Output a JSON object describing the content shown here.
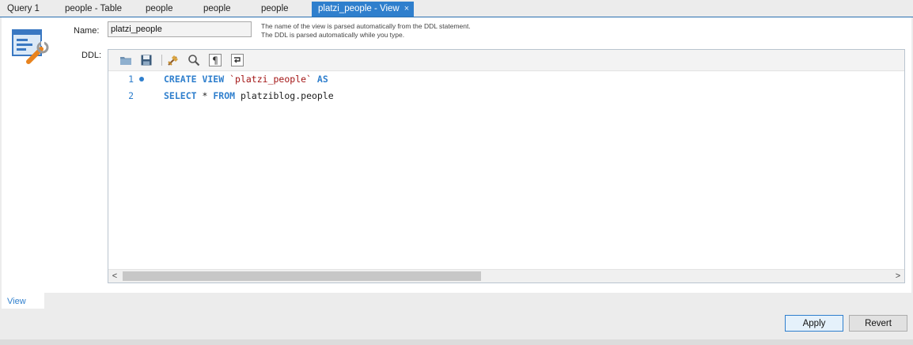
{
  "tabs": [
    {
      "label": "Query 1"
    },
    {
      "label": "people - Table"
    },
    {
      "label": "people"
    },
    {
      "label": "people"
    },
    {
      "label": "people"
    },
    {
      "label": "platzi_people - View",
      "active": true,
      "close": "×"
    }
  ],
  "form": {
    "name_label": "Name:",
    "name_value": "platzi_people",
    "hint": "The name of the view is parsed automatically from the DDL statement. The DDL is parsed automatically while you type.",
    "ddl_label": "DDL:"
  },
  "toolbar_icons": [
    "open-folder-icon",
    "save-icon",
    "beautify-icon",
    "find-icon",
    "invisible-chars-icon",
    "word-wrap-icon"
  ],
  "code": {
    "lines": [
      {
        "number": "1",
        "kw1": "CREATE VIEW",
        "str": "`platzi_people`",
        "kw2": "AS"
      },
      {
        "number": "2",
        "kw1": "SELECT",
        "plain1": "*",
        "kw2": "FROM",
        "plain2": "platziblog.people"
      }
    ]
  },
  "scroll": {
    "left": "<",
    "right": ">"
  },
  "bottom_tab": {
    "label": "View"
  },
  "buttons": {
    "apply": "Apply",
    "revert": "Revert"
  },
  "colors": {
    "accent": "#2f7fcd",
    "string": "#a31515"
  }
}
